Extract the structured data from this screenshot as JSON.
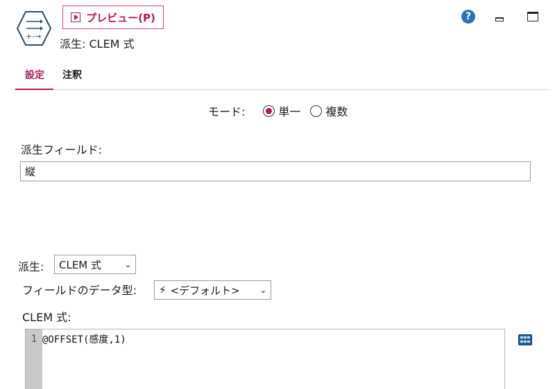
{
  "header": {
    "preview_label": "プレビュー(P)",
    "node_title": "派生: CLEM 式",
    "help_glyph": "?"
  },
  "tabs": [
    {
      "label": "設定",
      "active": true
    },
    {
      "label": "注釈",
      "active": false
    }
  ],
  "mode": {
    "label": "モード:",
    "options": [
      {
        "label": "単一",
        "selected": true
      },
      {
        "label": "複数",
        "selected": false
      }
    ]
  },
  "derive_field": {
    "label": "派生フィールド:",
    "value": "縦"
  },
  "derive_as": {
    "label": "派生:",
    "selected": "CLEM 式"
  },
  "field_type": {
    "label": "フィールドのデータ型:",
    "selected": "<デフォルト>"
  },
  "clem": {
    "label": "CLEM 式:",
    "line_number": "1",
    "code": "@OFFSET(感度,1)"
  },
  "colors": {
    "accent": "#b0195c",
    "help_blue": "#2f6fb7",
    "gutter": "#c9c9c9"
  },
  "icons": {
    "node": "derive-node-icon",
    "preview": "play-icon",
    "help": "help-icon",
    "minimize": "minimize-icon",
    "maximize": "maximize-icon",
    "type": "lightning-bolt-icon",
    "calculator": "expression-builder-icon"
  }
}
